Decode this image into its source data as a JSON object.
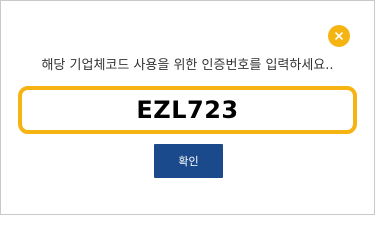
{
  "dialog": {
    "prompt": "해당 기업체코드 사용을 위한 인증번호를 입력하세요..",
    "code_value": "EZL723",
    "confirm_label": "확인",
    "close_icon": "close-icon"
  },
  "colors": {
    "accent": "#f5b412",
    "button": "#1b4a8c",
    "text": "#333333",
    "border": "#c9c9c9"
  }
}
